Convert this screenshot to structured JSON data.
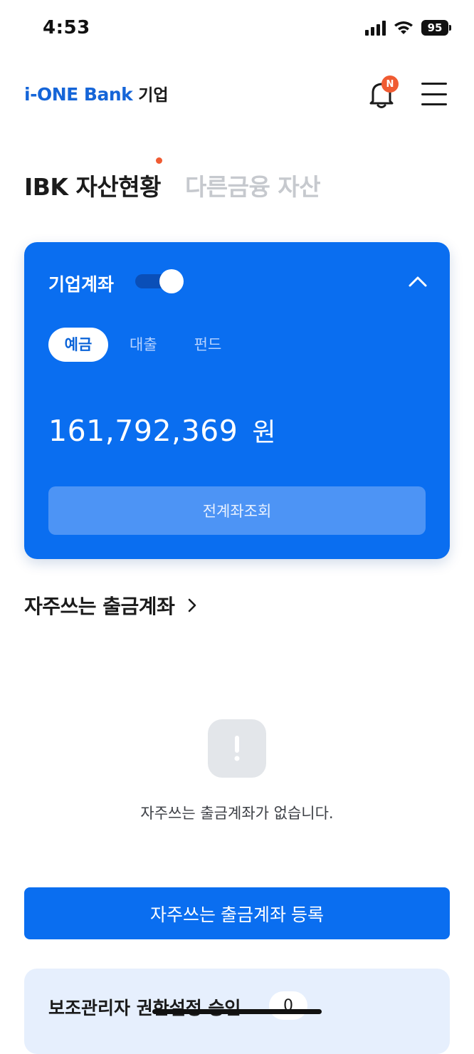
{
  "status_bar": {
    "time": "4:53",
    "battery": "95"
  },
  "header": {
    "logo_brand": "i-ONE Bank",
    "logo_sub": "기업",
    "notification_badge": "N"
  },
  "section_tabs": [
    {
      "label": "IBK 자산현황",
      "active": true
    },
    {
      "label": "다른금융 자산",
      "active": false
    }
  ],
  "asset_card": {
    "title": "기업계좌",
    "toggle_on": true,
    "product_tabs": [
      {
        "label": "예금",
        "active": true
      },
      {
        "label": "대출",
        "active": false
      },
      {
        "label": "펀드",
        "active": false
      }
    ],
    "amount": "161,792,369",
    "unit": "원",
    "all_accounts_label": "전계좌조회"
  },
  "frequent": {
    "title": "자주쓰는 출금계좌",
    "empty_text": "자주쓰는 출금계좌가 없습니다.",
    "register_label": "자주쓰는 출금계좌 등록"
  },
  "sub_admin": {
    "label": "보조관리자 권한설정 승인",
    "count": "0"
  },
  "colors": {
    "brand_blue": "#0a6ef0",
    "alert_orange": "#f05b32"
  }
}
